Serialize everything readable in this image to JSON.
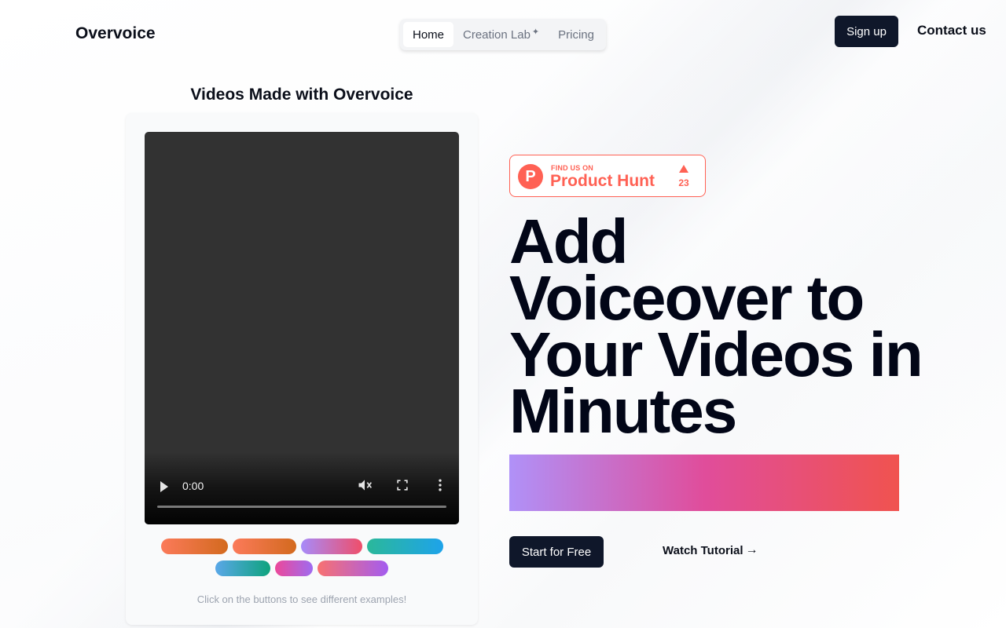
{
  "header": {
    "logo": "Overvoice",
    "nav": [
      {
        "label": "Home",
        "active": true
      },
      {
        "label": "Creation Lab",
        "badge_icon": "sparkle-icon"
      },
      {
        "label": "Pricing"
      }
    ],
    "signup_label": "Sign up",
    "contact_label": "Contact us"
  },
  "videos": {
    "title": "Videos Made with Overvoice",
    "player": {
      "time": "0:00",
      "progress": 0,
      "muted": true
    },
    "example_buttons": [
      {
        "gradient": [
          "#fb7a5a",
          "#d36a1e"
        ]
      },
      {
        "gradient": [
          "#fb7a5a",
          "#d36a1e"
        ]
      },
      {
        "gradient": [
          "#a78bfa",
          "#ef4e6a"
        ]
      },
      {
        "gradient": [
          "#2bb89a",
          "#1ea3ea"
        ]
      },
      {
        "gradient": [
          "#5aa7e8",
          "#0ea37d"
        ]
      },
      {
        "gradient": [
          "#ec4899",
          "#9f6bf0"
        ]
      },
      {
        "gradient": [
          "#f87171",
          "#a35cf0"
        ]
      }
    ],
    "hint": "Click on the buttons to see different examples!"
  },
  "hero": {
    "product_hunt": {
      "small": "FIND US ON",
      "big": "Product Hunt",
      "count": "23",
      "logo_letter": "P",
      "color": "#ff6154"
    },
    "headline_lines": [
      "Add",
      "Voiceover to",
      "Your Videos in",
      "Minutes"
    ],
    "gradient_colors": [
      "#b091f8",
      "#e04d9b",
      "#f0534f"
    ],
    "start_label": "Start for Free",
    "tutorial_label": "Watch Tutorial",
    "tutorial_arrow": "→"
  }
}
